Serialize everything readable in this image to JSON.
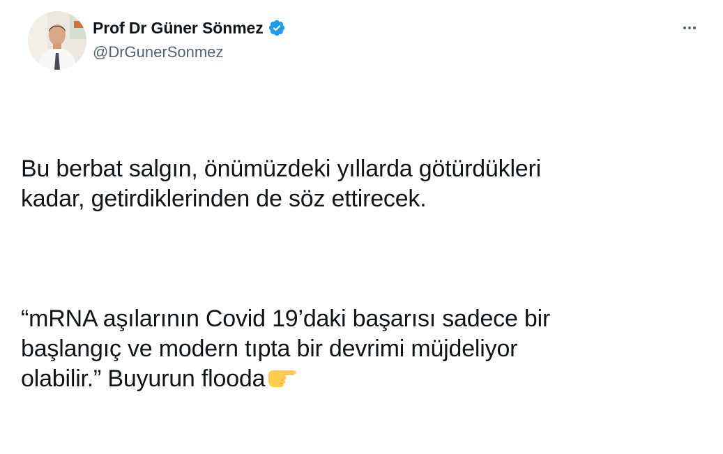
{
  "author": {
    "display_name": "Prof Dr Güner Sönmez",
    "handle": "@DrGunerSonmez",
    "verified": true,
    "avatar": "profile-photo"
  },
  "actions": {
    "more_icon": "more-horizontal-icon"
  },
  "tweet": {
    "paragraphs": [
      "Bu berbat salgın, önümüzdeki yıllarda götürdükleri\nkadar, getirdiklerinden de söz ettirecek.",
      "“mRNA aşılarının Covid 19’daki başarısı sadece bir\nbaşlangıç ve modern tıpta bir devrimi müjdeliyor\nolabilir.” Buyurun flooda"
    ],
    "trailing_emoji": "backhand-index-pointing-right"
  },
  "colors": {
    "text": "#0f1419",
    "secondary": "#536471",
    "verified": "#1d9bf0"
  }
}
